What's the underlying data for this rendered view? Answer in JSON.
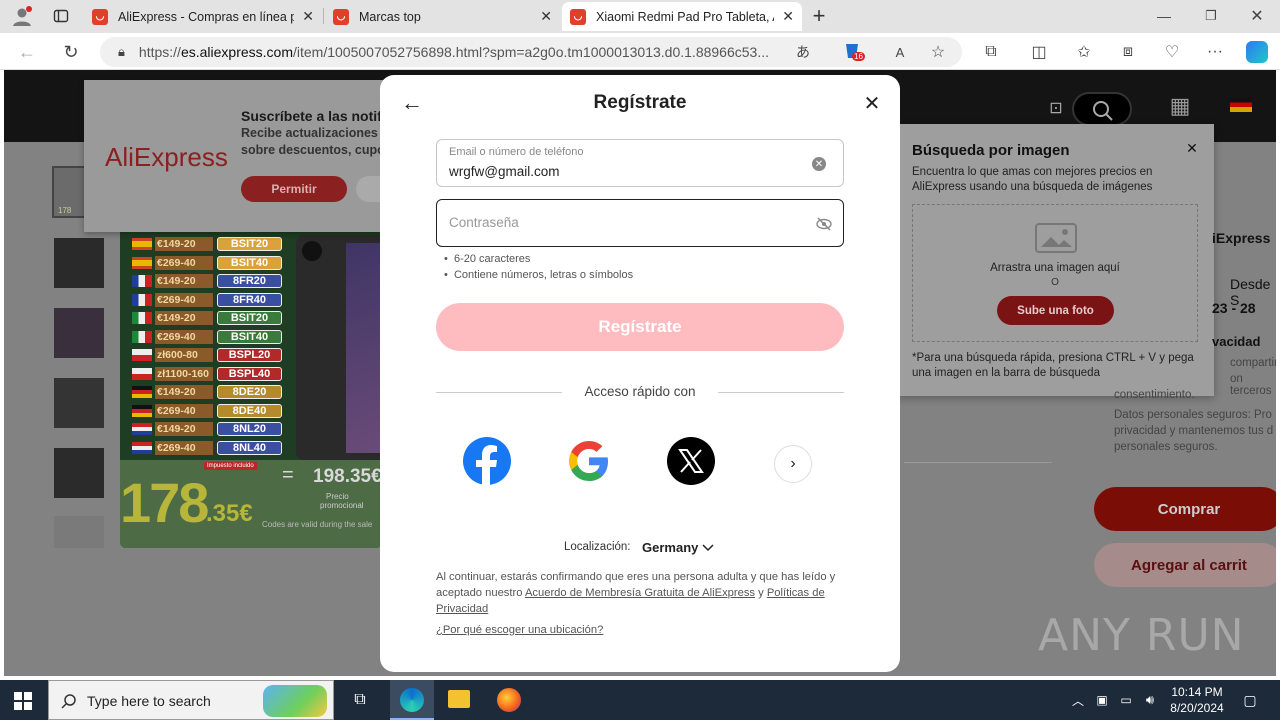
{
  "browser": {
    "tabs": [
      {
        "title": "AliExpress - Compras en línea pa"
      },
      {
        "title": "Marcas top"
      },
      {
        "title": "Xiaomi Redmi Pad Pro Tableta, A"
      }
    ],
    "url_prefix": "https://",
    "url_host": "es.aliexpress.com",
    "url_path": "/item/1005007052756898.html?spm=a2g0o.tm1000013013.d0.1.88966c53...",
    "badge_count": "16"
  },
  "notify_popup": {
    "brand": "AliExpress",
    "title": "Suscríbete a las notif",
    "line1": "Recibe actualizaciones",
    "line2": "sobre descuentos, cupo",
    "allow_label": "Permitir"
  },
  "promo": {
    "codes": [
      {
        "amount": "€149-20",
        "code": "BSIT20",
        "flag": "es"
      },
      {
        "amount": "€269-40",
        "code": "BSIT40",
        "flag": "es"
      },
      {
        "amount": "€149-20",
        "code": "8FR20",
        "flag": "fr"
      },
      {
        "amount": "€269-40",
        "code": "8FR40",
        "flag": "fr"
      },
      {
        "amount": "€149-20",
        "code": "BSIT20",
        "flag": "it"
      },
      {
        "amount": "€269-40",
        "code": "BSIT40",
        "flag": "it"
      },
      {
        "amount": "zł600-80",
        "code": "BSPL20",
        "flag": "pl"
      },
      {
        "amount": "zł1100-160",
        "code": "BSPL40",
        "flag": "pl"
      },
      {
        "amount": "€149-20",
        "code": "8DE20",
        "flag": "de"
      },
      {
        "amount": "€269-40",
        "code": "8DE40",
        "flag": "de"
      },
      {
        "amount": "€149-20",
        "code": "8NL20",
        "flag": "nl"
      },
      {
        "amount": "€269-40",
        "code": "8NL40",
        "flag": "nl"
      }
    ],
    "price_big": "178",
    "price_cents": ".35€",
    "eq_sign": "=",
    "price_right": "198.35€",
    "price_note_1": "Precio",
    "price_note_2": "promocional",
    "footnote": "Codes are valid during the sale",
    "badge": "Impuesto incluido",
    "thumb_label": "178"
  },
  "image_search": {
    "title": "Búsqueda por imagen",
    "desc": "Encuentra lo que amas con mejores precios en AliExpress usando una búsqueda de imágenes",
    "drop_text": "Arrastra una imagen aquí",
    "or_text": "O",
    "upload_label": "Sube una foto",
    "hint": "*Para una búsqueda rápida, presiona CTRL + V y pega una imagen en la barra de búsqueda"
  },
  "right_panel": {
    "brand_frag": "iExpress",
    "ship_frag": "Desde S",
    "date_frag": "23 - 28",
    "privacy_title": "vacidad",
    "privacy_l1": "compartire",
    "privacy_l2": "on terceros",
    "privacy_l3": "consentimiento.",
    "privacy_l4": "Datos personales seguros: Pro",
    "privacy_l5": "privacidad y mantenemos tus d",
    "privacy_l6": "personales seguros.",
    "buy_label": "Comprar",
    "cart_label": "Agregar al carrit"
  },
  "modal": {
    "title": "Regístrate",
    "email_label": "Email o número de teléfono",
    "email_value": "wrgfw@gmail.com",
    "password_placeholder": "Contraseña",
    "rule1": "6-20 caracteres",
    "rule2": "Contiene números, letras o símbolos",
    "submit_label": "Regístrate",
    "divider_text": "Acceso rápido con",
    "location_label": "Localización:",
    "location_value": "Germany",
    "legal_1": "Al continuar, estarás confirmando que eres una persona adulta y que has leído y aceptado nuestro ",
    "legal_link1": "Acuerdo de Membresía Gratuita de AliExpress",
    "legal_and": " y ",
    "legal_link2": "Políticas de Privacidad",
    "why_link": "¿Por qué escoger una ubicación?"
  },
  "watermark": "ANY RUN",
  "taskbar": {
    "search_placeholder": "Type here to search",
    "time": "10:14 PM",
    "date": "8/20/2024"
  },
  "colors": {
    "ali_red": "#e62e04",
    "submit_pink": "#ffbcc0",
    "facebook": "#1877f2",
    "taskbar": "#1c2a3a"
  }
}
